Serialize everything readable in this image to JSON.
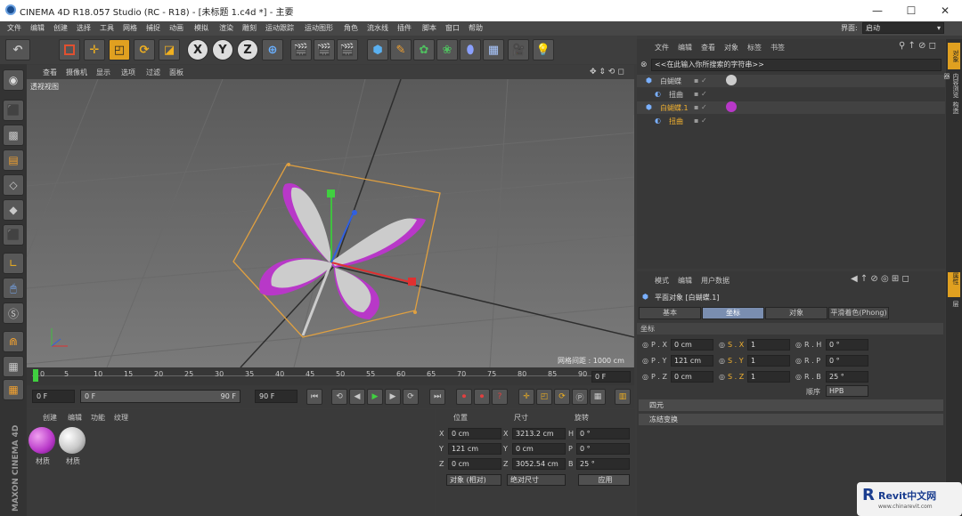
{
  "window": {
    "title": "CINEMA 4D R18.057 Studio (RC - R18) - [未标题 1.c4d *] - 主要",
    "min": "—",
    "max": "☐",
    "close": "✕"
  },
  "menubar": {
    "items": [
      "文件",
      "编辑",
      "创建",
      "选择",
      "工具",
      "网格",
      "捕捉",
      "动画",
      "模拟",
      "渲染",
      "雕刻",
      "运动跟踪",
      "运动图形",
      "角色",
      "流水线",
      "插件",
      "脚本",
      "窗口",
      "帮助"
    ],
    "layout_label": "界面:",
    "layout_value": "启动"
  },
  "toolbar": {
    "x": "X",
    "y": "Y",
    "z": "Z"
  },
  "viewport": {
    "menu": [
      "查看",
      "摄像机",
      "显示",
      "选项",
      "过滤",
      "面板"
    ],
    "label": "透视视图",
    "grid_info": "网格间距 : 1000 cm"
  },
  "timeline": {
    "ticks": [
      "0",
      "5",
      "10",
      "15",
      "20",
      "25",
      "30",
      "35",
      "40",
      "45",
      "50",
      "55",
      "60",
      "65",
      "70",
      "75",
      "80",
      "85",
      "90"
    ],
    "frame_end": "0 F"
  },
  "transport": {
    "start": "0 F",
    "range_start": "0 F",
    "range_end": "90 F",
    "end": "90 F"
  },
  "materials": {
    "menu": [
      "创建",
      "编辑",
      "功能",
      "纹理"
    ],
    "items": [
      {
        "label": "材质",
        "color": "#c040c0"
      },
      {
        "label": "材质",
        "color": "#d0d0d0"
      }
    ]
  },
  "coords": {
    "headers": [
      "位置",
      "尺寸",
      "旋转"
    ],
    "rows": [
      {
        "axis": "X",
        "pos": "0 cm",
        "size_axis": "X",
        "size": "3213.2 cm",
        "rot_axis": "H",
        "rot": "0 °"
      },
      {
        "axis": "Y",
        "pos": "121 cm",
        "size_axis": "Y",
        "size": "0 cm",
        "rot_axis": "P",
        "rot": "0 °"
      },
      {
        "axis": "Z",
        "pos": "0 cm",
        "size_axis": "Z",
        "size": "3052.54 cm",
        "rot_axis": "B",
        "rot": "25 °"
      }
    ],
    "mode": "对象 (相对)",
    "size_mode": "绝对尺寸",
    "apply": "应用"
  },
  "objects": {
    "menu": [
      "文件",
      "编辑",
      "查看",
      "对象",
      "标签",
      "书签"
    ],
    "search_placeholder": "<<在此输入你所搜索的字符串>>",
    "tree": [
      {
        "name": "白蝴蝶",
        "indent": 0,
        "color": "#c8c8c8"
      },
      {
        "name": "扭曲",
        "indent": 1,
        "color": "#c8c8c8"
      },
      {
        "name": "白蝴蝶.1",
        "indent": 0,
        "color": "#f0b030"
      },
      {
        "name": "扭曲",
        "indent": 1,
        "color": "#f0b030"
      }
    ]
  },
  "attributes": {
    "menu": [
      "模式",
      "编辑",
      "用户数据"
    ],
    "title": "平面对象 [白蝴蝶.1]",
    "tabs": [
      "基本",
      "坐标",
      "对象",
      "平滑着色(Phong)"
    ],
    "section": "坐标",
    "rows": [
      {
        "p": "P . X",
        "pv": "0 cm",
        "s": "S . X",
        "sv": "1",
        "r": "R . H",
        "rv": "0 °"
      },
      {
        "p": "P . Y",
        "pv": "121 cm",
        "s": "S . Y",
        "sv": "1",
        "r": "R . P",
        "rv": "0 °"
      },
      {
        "p": "P . Z",
        "pv": "0 cm",
        "s": "S . Z",
        "sv": "1",
        "r": "R . B",
        "rv": "25 °"
      }
    ],
    "order_label": "顺序",
    "order_value": "HPB",
    "quaternion": "四元",
    "freeze": "冻结变换"
  },
  "right_strip": [
    "对象",
    "内容浏览器",
    "构造",
    "属性",
    "层"
  ],
  "watermark": {
    "brand": "Revit中文网",
    "url": "www.chinarevit.com"
  },
  "brand": {
    "maxon": "MAXON",
    "c4d": "CINEMA 4D"
  }
}
